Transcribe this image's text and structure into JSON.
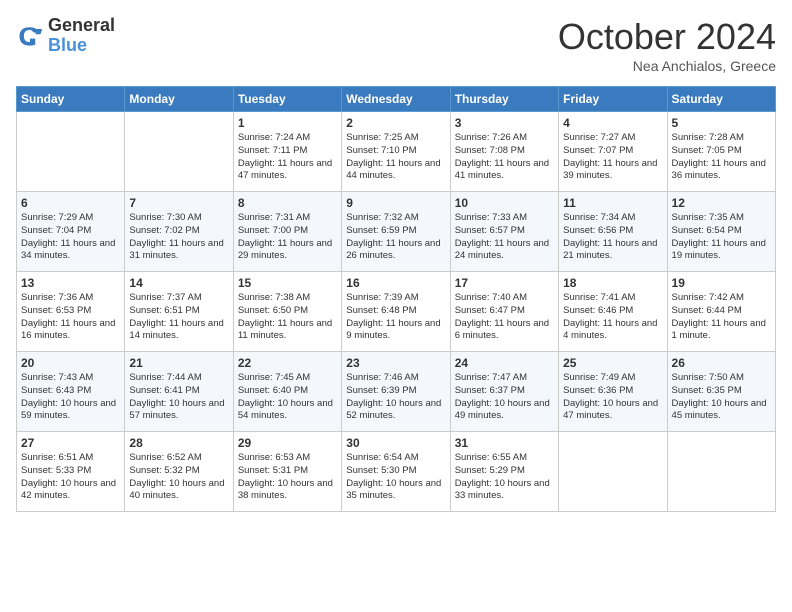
{
  "header": {
    "logo_general": "General",
    "logo_blue": "Blue",
    "month": "October 2024",
    "location": "Nea Anchialos, Greece"
  },
  "days_of_week": [
    "Sunday",
    "Monday",
    "Tuesday",
    "Wednesday",
    "Thursday",
    "Friday",
    "Saturday"
  ],
  "weeks": [
    [
      {
        "day": "",
        "info": ""
      },
      {
        "day": "",
        "info": ""
      },
      {
        "day": "1",
        "sunrise": "7:24 AM",
        "sunset": "7:11 PM",
        "daylight": "11 hours and 47 minutes."
      },
      {
        "day": "2",
        "sunrise": "7:25 AM",
        "sunset": "7:10 PM",
        "daylight": "11 hours and 44 minutes."
      },
      {
        "day": "3",
        "sunrise": "7:26 AM",
        "sunset": "7:08 PM",
        "daylight": "11 hours and 41 minutes."
      },
      {
        "day": "4",
        "sunrise": "7:27 AM",
        "sunset": "7:07 PM",
        "daylight": "11 hours and 39 minutes."
      },
      {
        "day": "5",
        "sunrise": "7:28 AM",
        "sunset": "7:05 PM",
        "daylight": "11 hours and 36 minutes."
      }
    ],
    [
      {
        "day": "6",
        "sunrise": "7:29 AM",
        "sunset": "7:04 PM",
        "daylight": "11 hours and 34 minutes."
      },
      {
        "day": "7",
        "sunrise": "7:30 AM",
        "sunset": "7:02 PM",
        "daylight": "11 hours and 31 minutes."
      },
      {
        "day": "8",
        "sunrise": "7:31 AM",
        "sunset": "7:00 PM",
        "daylight": "11 hours and 29 minutes."
      },
      {
        "day": "9",
        "sunrise": "7:32 AM",
        "sunset": "6:59 PM",
        "daylight": "11 hours and 26 minutes."
      },
      {
        "day": "10",
        "sunrise": "7:33 AM",
        "sunset": "6:57 PM",
        "daylight": "11 hours and 24 minutes."
      },
      {
        "day": "11",
        "sunrise": "7:34 AM",
        "sunset": "6:56 PM",
        "daylight": "11 hours and 21 minutes."
      },
      {
        "day": "12",
        "sunrise": "7:35 AM",
        "sunset": "6:54 PM",
        "daylight": "11 hours and 19 minutes."
      }
    ],
    [
      {
        "day": "13",
        "sunrise": "7:36 AM",
        "sunset": "6:53 PM",
        "daylight": "11 hours and 16 minutes."
      },
      {
        "day": "14",
        "sunrise": "7:37 AM",
        "sunset": "6:51 PM",
        "daylight": "11 hours and 14 minutes."
      },
      {
        "day": "15",
        "sunrise": "7:38 AM",
        "sunset": "6:50 PM",
        "daylight": "11 hours and 11 minutes."
      },
      {
        "day": "16",
        "sunrise": "7:39 AM",
        "sunset": "6:48 PM",
        "daylight": "11 hours and 9 minutes."
      },
      {
        "day": "17",
        "sunrise": "7:40 AM",
        "sunset": "6:47 PM",
        "daylight": "11 hours and 6 minutes."
      },
      {
        "day": "18",
        "sunrise": "7:41 AM",
        "sunset": "6:46 PM",
        "daylight": "11 hours and 4 minutes."
      },
      {
        "day": "19",
        "sunrise": "7:42 AM",
        "sunset": "6:44 PM",
        "daylight": "11 hours and 1 minute."
      }
    ],
    [
      {
        "day": "20",
        "sunrise": "7:43 AM",
        "sunset": "6:43 PM",
        "daylight": "10 hours and 59 minutes."
      },
      {
        "day": "21",
        "sunrise": "7:44 AM",
        "sunset": "6:41 PM",
        "daylight": "10 hours and 57 minutes."
      },
      {
        "day": "22",
        "sunrise": "7:45 AM",
        "sunset": "6:40 PM",
        "daylight": "10 hours and 54 minutes."
      },
      {
        "day": "23",
        "sunrise": "7:46 AM",
        "sunset": "6:39 PM",
        "daylight": "10 hours and 52 minutes."
      },
      {
        "day": "24",
        "sunrise": "7:47 AM",
        "sunset": "6:37 PM",
        "daylight": "10 hours and 49 minutes."
      },
      {
        "day": "25",
        "sunrise": "7:49 AM",
        "sunset": "6:36 PM",
        "daylight": "10 hours and 47 minutes."
      },
      {
        "day": "26",
        "sunrise": "7:50 AM",
        "sunset": "6:35 PM",
        "daylight": "10 hours and 45 minutes."
      }
    ],
    [
      {
        "day": "27",
        "sunrise": "6:51 AM",
        "sunset": "5:33 PM",
        "daylight": "10 hours and 42 minutes."
      },
      {
        "day": "28",
        "sunrise": "6:52 AM",
        "sunset": "5:32 PM",
        "daylight": "10 hours and 40 minutes."
      },
      {
        "day": "29",
        "sunrise": "6:53 AM",
        "sunset": "5:31 PM",
        "daylight": "10 hours and 38 minutes."
      },
      {
        "day": "30",
        "sunrise": "6:54 AM",
        "sunset": "5:30 PM",
        "daylight": "10 hours and 35 minutes."
      },
      {
        "day": "31",
        "sunrise": "6:55 AM",
        "sunset": "5:29 PM",
        "daylight": "10 hours and 33 minutes."
      },
      {
        "day": "",
        "info": ""
      },
      {
        "day": "",
        "info": ""
      }
    ]
  ],
  "labels": {
    "sunrise": "Sunrise:",
    "sunset": "Sunset:",
    "daylight": "Daylight:"
  }
}
